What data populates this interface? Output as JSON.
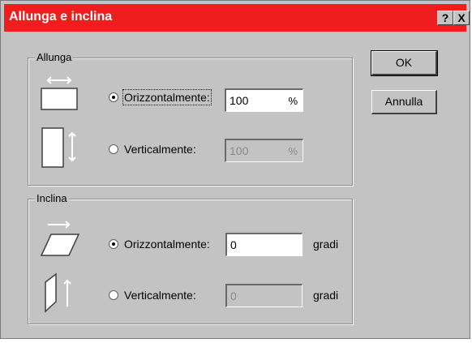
{
  "window": {
    "title": "Allunga e inclina",
    "help_glyph": "?",
    "close_glyph": "X"
  },
  "buttons": {
    "ok": "OK",
    "cancel": "Annulla"
  },
  "allunga": {
    "legend": "Allunga",
    "horizontal": {
      "label": "Orizzontalmente:",
      "value": "100",
      "unit": "%",
      "selected": true
    },
    "vertical": {
      "label": "Verticalmente:",
      "value": "100",
      "unit": "%",
      "selected": false
    }
  },
  "inclina": {
    "legend": "Inclina",
    "horizontal": {
      "label": "Orizzontalmente:",
      "value": "0",
      "unit": "gradi",
      "selected": true
    },
    "vertical": {
      "label": "Verticalmente:",
      "value": "0",
      "unit": "gradi",
      "selected": false
    }
  },
  "icons": [
    "stretch-horizontal-icon",
    "stretch-vertical-icon",
    "skew-horizontal-icon",
    "skew-vertical-icon"
  ]
}
